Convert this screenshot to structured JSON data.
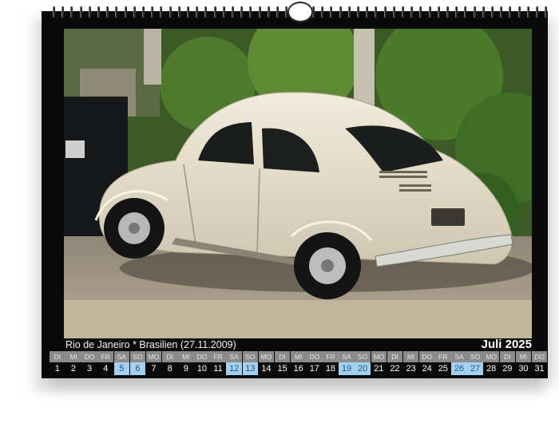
{
  "caption": "Rio de Janeiro * Brasilien (27.11.2009)",
  "month_label": "Juli 2025",
  "days": [
    {
      "wd": "DI",
      "d": "1",
      "we": false
    },
    {
      "wd": "MI",
      "d": "2",
      "we": false
    },
    {
      "wd": "DO",
      "d": "3",
      "we": false
    },
    {
      "wd": "FR",
      "d": "4",
      "we": false
    },
    {
      "wd": "SA",
      "d": "5",
      "we": true
    },
    {
      "wd": "SO",
      "d": "6",
      "we": true
    },
    {
      "wd": "MO",
      "d": "7",
      "we": false
    },
    {
      "wd": "DI",
      "d": "8",
      "we": false
    },
    {
      "wd": "MI",
      "d": "9",
      "we": false
    },
    {
      "wd": "DO",
      "d": "10",
      "we": false
    },
    {
      "wd": "FR",
      "d": "11",
      "we": false
    },
    {
      "wd": "SA",
      "d": "12",
      "we": true
    },
    {
      "wd": "SO",
      "d": "13",
      "we": true
    },
    {
      "wd": "MO",
      "d": "14",
      "we": false
    },
    {
      "wd": "DI",
      "d": "15",
      "we": false
    },
    {
      "wd": "MI",
      "d": "16",
      "we": false
    },
    {
      "wd": "DO",
      "d": "17",
      "we": false
    },
    {
      "wd": "FR",
      "d": "18",
      "we": false
    },
    {
      "wd": "SA",
      "d": "19",
      "we": true
    },
    {
      "wd": "SO",
      "d": "20",
      "we": true
    },
    {
      "wd": "MO",
      "d": "21",
      "we": false
    },
    {
      "wd": "DI",
      "d": "22",
      "we": false
    },
    {
      "wd": "MI",
      "d": "23",
      "we": false
    },
    {
      "wd": "DO",
      "d": "24",
      "we": false
    },
    {
      "wd": "FR",
      "d": "25",
      "we": false
    },
    {
      "wd": "SA",
      "d": "26",
      "we": true
    },
    {
      "wd": "SO",
      "d": "27",
      "we": true
    },
    {
      "wd": "MO",
      "d": "28",
      "we": false
    },
    {
      "wd": "DI",
      "d": "29",
      "we": false
    },
    {
      "wd": "MI",
      "d": "30",
      "we": false
    },
    {
      "wd": "DO",
      "d": "31",
      "we": false
    }
  ],
  "colors": {
    "frame": "#0a0a0a",
    "weekday_header": "#8b8b8b",
    "weekend_highlight": "#a5cfef",
    "car_body": "#e8e2cf"
  }
}
